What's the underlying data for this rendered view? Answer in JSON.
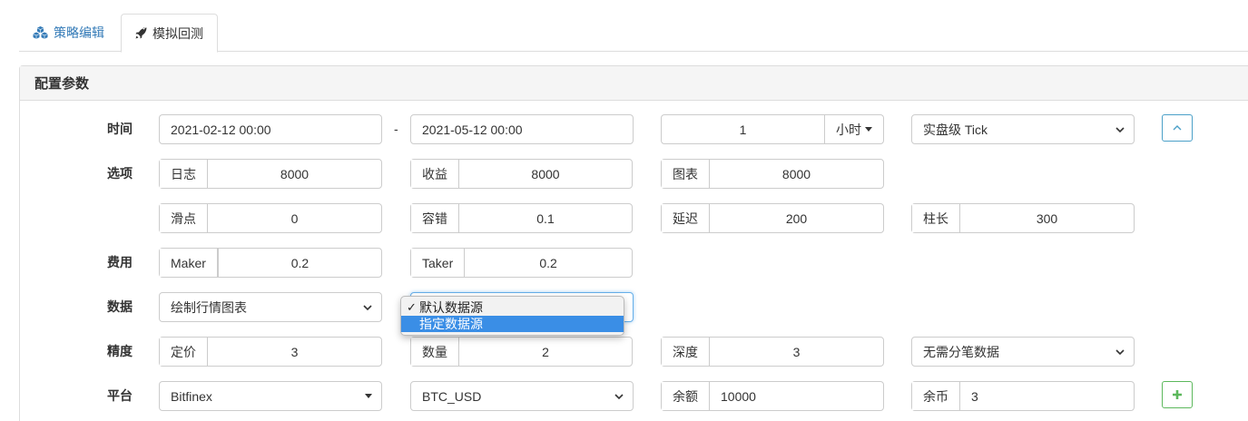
{
  "tabs": [
    {
      "label": "策略编辑",
      "active": false
    },
    {
      "label": "模拟回测",
      "active": true
    }
  ],
  "panel": {
    "title": "配置参数"
  },
  "rows": {
    "time": {
      "label": "时间",
      "start": "2021-02-12 00:00",
      "end": "2021-05-12 00:00",
      "separator": "-",
      "period_value": "1",
      "period_unit": "小时",
      "tick_mode": "实盘级 Tick"
    },
    "options": {
      "label": "选项",
      "log_label": "日志",
      "log_value": "8000",
      "profit_label": "收益",
      "profit_value": "8000",
      "chart_label": "图表",
      "chart_value": "8000"
    },
    "options2": {
      "slippage_label": "滑点",
      "slippage_value": "0",
      "tolerance_label": "容错",
      "tolerance_value": "0.1",
      "delay_label": "延迟",
      "delay_value": "200",
      "bar_label": "柱长",
      "bar_value": "300"
    },
    "fee": {
      "label": "费用",
      "maker_label": "Maker",
      "maker_value": "0.2",
      "taker_label": "Taker",
      "taker_value": "0.2"
    },
    "data": {
      "label": "数据",
      "chart_mode": "绘制行情图表"
    },
    "precision": {
      "label": "精度",
      "price_label": "定价",
      "price_value": "3",
      "qty_label": "数量",
      "qty_value": "2",
      "depth_label": "深度",
      "depth_value": "3",
      "tick_data": "无需分笔数据"
    },
    "platform": {
      "label": "平台",
      "exchange": "Bitfinex",
      "pair": "BTC_USD",
      "balance_label": "余额",
      "balance_value": "10000",
      "coin_label": "余币",
      "coin_value": "3"
    }
  },
  "dropdown": {
    "options": [
      {
        "label": "默认数据源",
        "checked": true,
        "highlighted": false
      },
      {
        "label": "指定数据源",
        "checked": false,
        "highlighted": true
      }
    ]
  },
  "colors": {
    "link": "#337ab7",
    "success": "#5cb85c",
    "highlight": "#3a8ee6"
  }
}
